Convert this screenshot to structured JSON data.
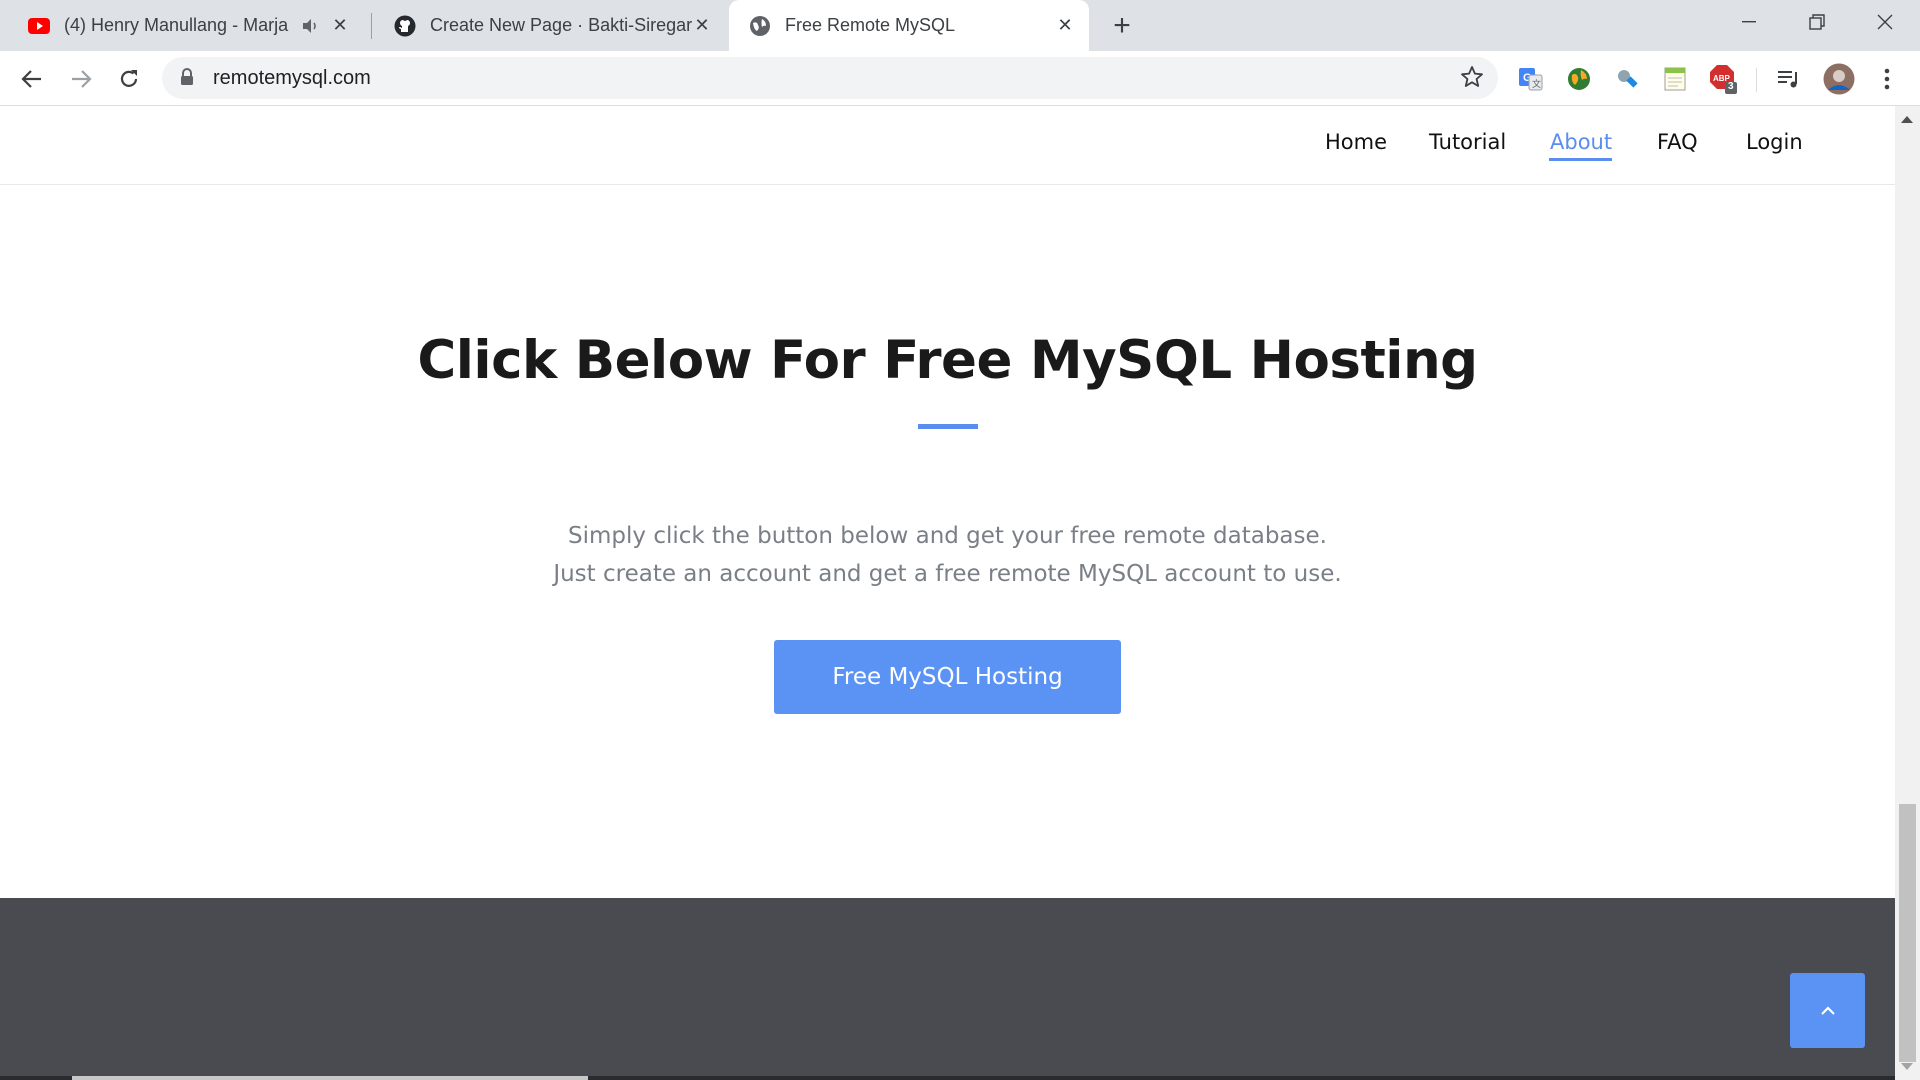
{
  "browser": {
    "tabs": [
      {
        "title": "(4) Henry Manullang - Marja",
        "favicon": "youtube-icon",
        "audio": true,
        "active": false
      },
      {
        "title": "Create New Page · Bakti-Siregar/",
        "favicon": "github-icon",
        "active": false
      },
      {
        "title": "Free Remote MySQL",
        "favicon": "globe-icon",
        "active": true
      }
    ],
    "url": "remotemysql.com",
    "extensions": [
      "google-translate-icon",
      "globe-extension-icon",
      "satellite-icon",
      "notepad-icon",
      "adblock-icon",
      "playlist-icon",
      "profile-avatar"
    ],
    "adblock_badge": "3",
    "colors": {
      "tabstrip": "#dee1e6",
      "omnibox": "#f1f3f4"
    }
  },
  "site": {
    "nav": [
      {
        "label": "Home",
        "active": false
      },
      {
        "label": "Tutorial",
        "active": false
      },
      {
        "label": "About",
        "active": true
      },
      {
        "label": "FAQ",
        "active": false
      },
      {
        "label": "Login",
        "active": false
      }
    ],
    "hero": {
      "title": "Click Below For Free MySQL Hosting",
      "line1": "Simply click the button below and get your free remote database.",
      "line2": "Just create an account and get a free remote MySQL account to use.",
      "cta": "Free MySQL Hosting"
    },
    "colors": {
      "accent": "#5b93f5",
      "footer": "#494b50",
      "nav_active": "#5b8def"
    }
  }
}
